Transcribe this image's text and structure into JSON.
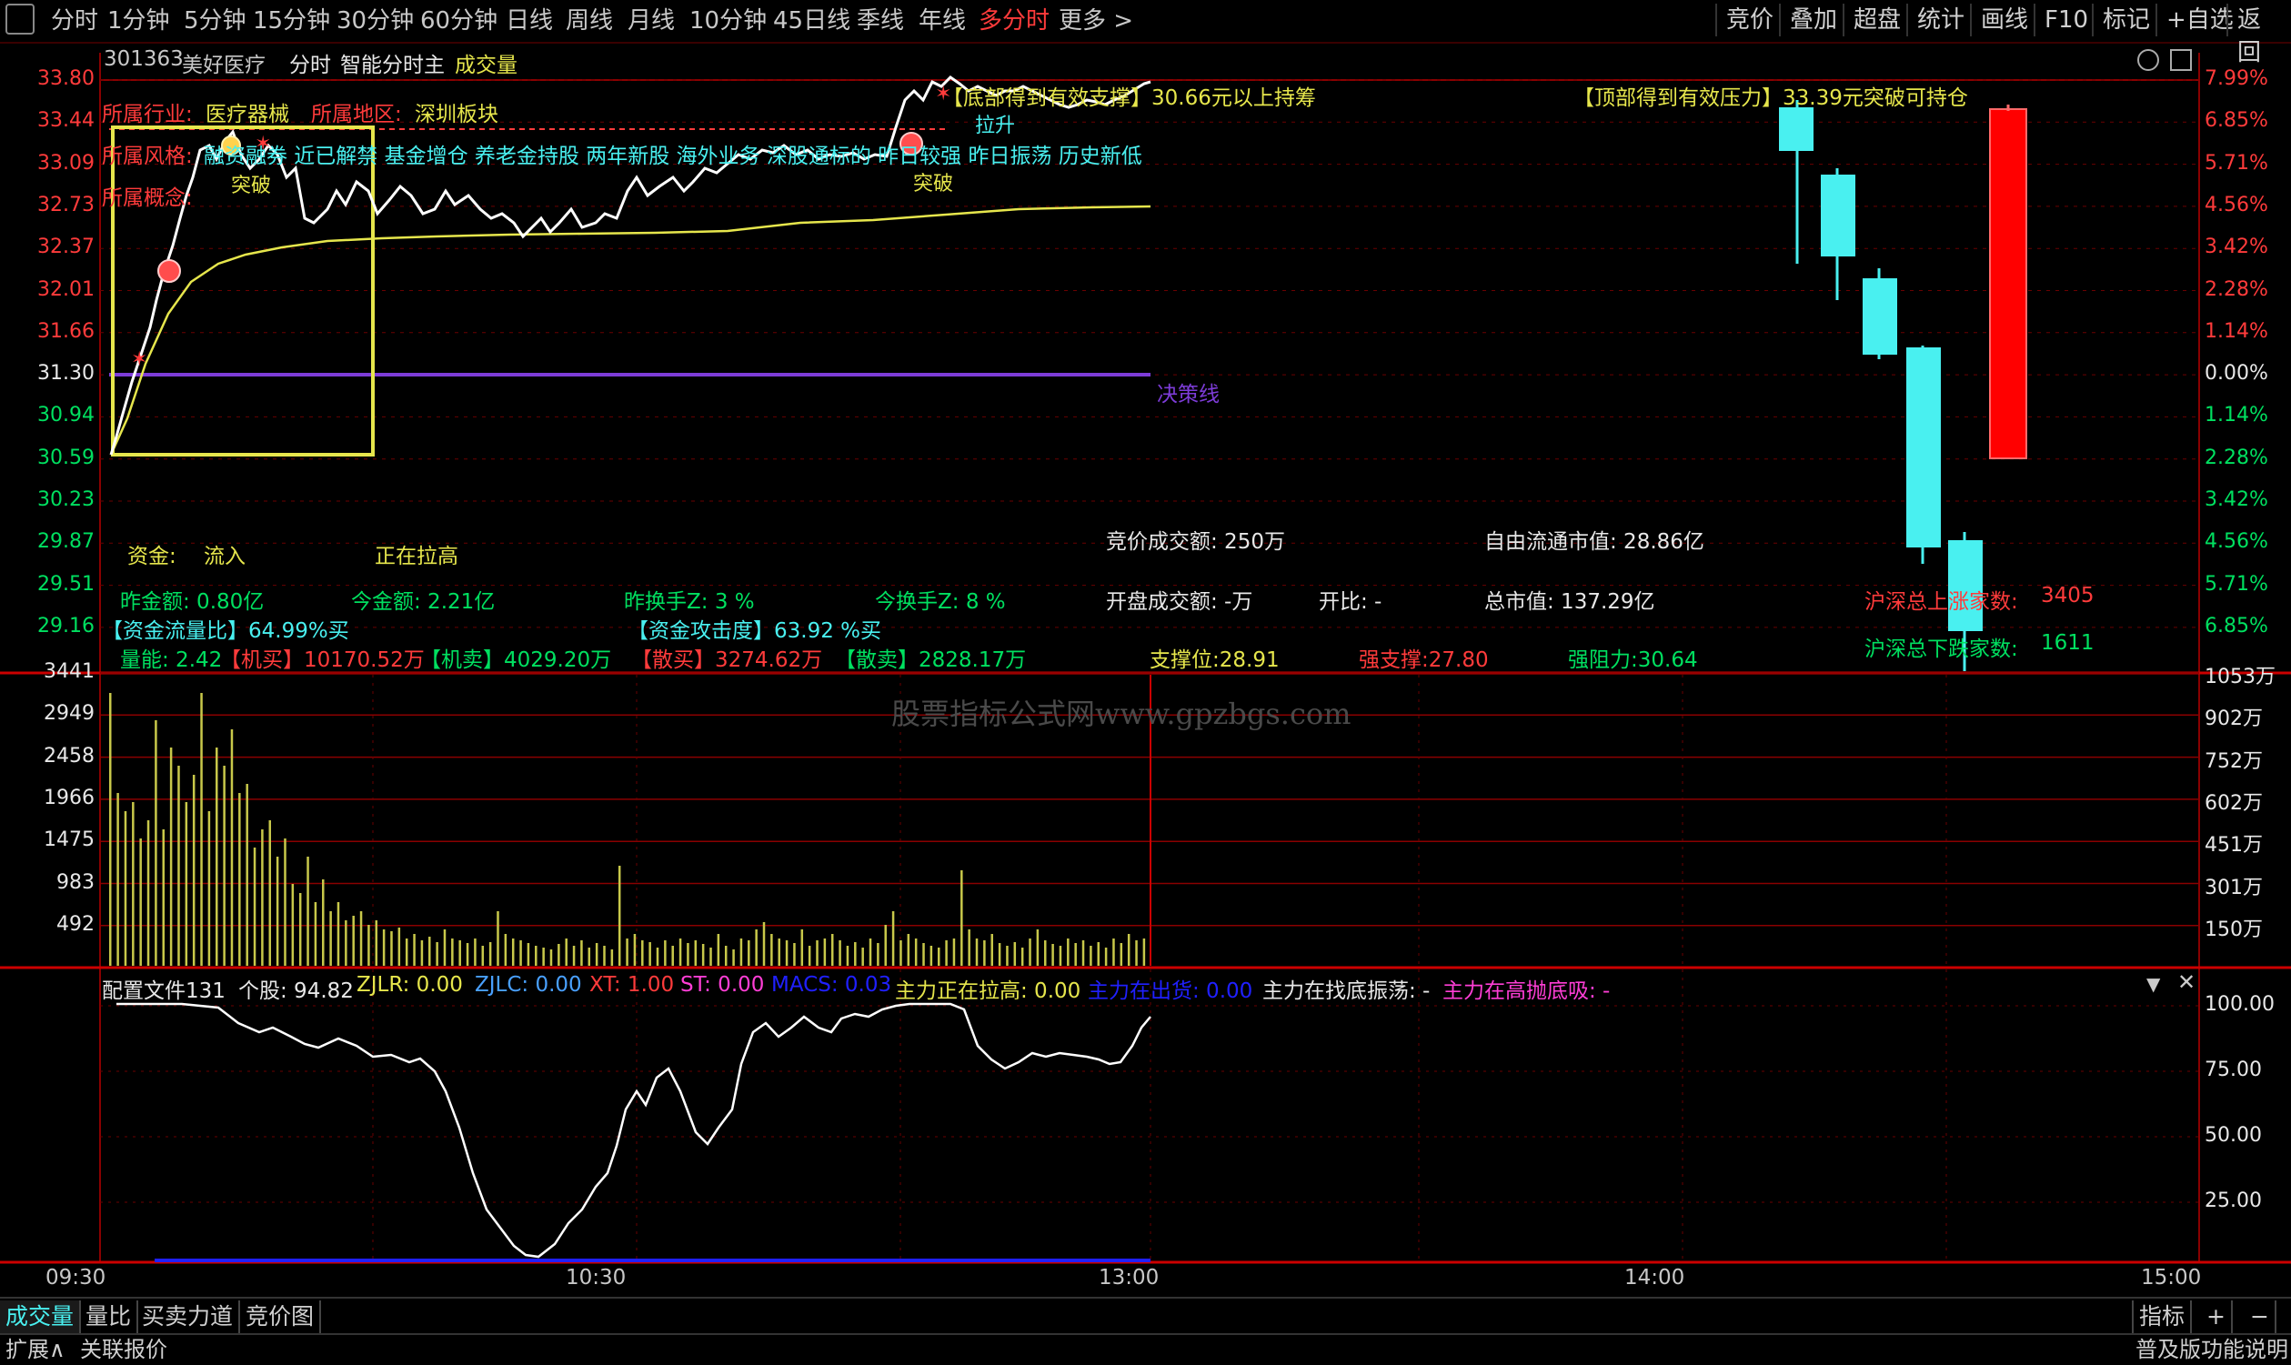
{
  "toolbar": {
    "periods": [
      "分时",
      "1分钟",
      "5分钟",
      "15分钟",
      "30分钟",
      "60分钟",
      "日线",
      "周线",
      "月线",
      "10分钟",
      "45日线",
      "季线",
      "年线",
      "多分时",
      "更多 >"
    ],
    "active_period": "多分时",
    "right_buttons": [
      "竞价",
      "叠加",
      "超盘",
      "统计",
      "画线",
      "F10",
      "标记",
      "+自选",
      "返回"
    ]
  },
  "header": {
    "code": "301363",
    "name": "美好医疗",
    "mode": "分时",
    "indicator_main": "智能分时主",
    "indicator_sub": "成交量"
  },
  "info": {
    "industry_label": "所属行业:",
    "industry_value": "医疗器械",
    "region_label": "所属地区:",
    "region_value": "深圳板块",
    "style_label": "所属风格:",
    "style_value": "融资融券 近已解禁 基金增仓 养老金持股 两年新股 海外业务 深股通标的 昨日较强 昨日振荡 历史新低",
    "concept_label": "所属概念:",
    "bottom_support": "【底部得到有效支撑】30.66元以上持筹",
    "top_pressure": "【顶部得到有效压力】33.39元突破可持仓",
    "decision_line": "决策线",
    "break_label_1": "突破",
    "break_label_2": "突破",
    "pull_label": "拉升"
  },
  "price_axis": {
    "left": [
      "33.80",
      "33.44",
      "33.09",
      "32.73",
      "32.37",
      "32.01",
      "31.66",
      "31.30",
      "30.94",
      "30.59",
      "30.23",
      "29.87",
      "29.51",
      "29.16"
    ],
    "right": [
      "7.99%",
      "6.85%",
      "5.71%",
      "4.56%",
      "3.42%",
      "2.28%",
      "1.14%",
      "0.00%",
      "1.14%",
      "2.28%",
      "3.42%",
      "4.56%",
      "5.71%",
      "6.85%"
    ]
  },
  "stats": {
    "fund_label": "资金:",
    "fund_flow": "流入",
    "fund_state": "正在拉高",
    "yesterday_amount": "昨金额: 0.80亿",
    "today_amount": "今金额: 2.21亿",
    "yesterday_turnover": "昨换手Z: 3 %",
    "today_turnover": "今换手Z: 8 %",
    "flow_ratio": "【资金流量比】64.99%买",
    "attack": "【资金攻击度】63.92 %买",
    "volume_ratio": "量能: 2.42",
    "inst_buy_label": "【机买】",
    "inst_buy": "10170.52万",
    "inst_sell_label": "【机卖】",
    "inst_sell": "4029.20万",
    "retail_buy_label": "【散买】",
    "retail_buy": "3274.62万",
    "retail_sell_label": "【散卖】",
    "retail_sell": "2828.17万",
    "auction_amount": "竞价成交额: 250万",
    "open_amount": "开盘成交额: -万",
    "open_ratio": "开比: -",
    "float_cap": "自由流通市值: 28.86亿",
    "total_cap": "总市值: 137.29亿",
    "support": "支撑位:28.91",
    "strong_support": "强支撑:27.80",
    "strong_resist": "强阻力:30.64",
    "up_count_label": "沪深总上涨家数:",
    "up_count": "3405",
    "down_count_label": "沪深总下跌家数:",
    "down_count": "1611"
  },
  "volume_axis": {
    "left": [
      "3441",
      "2949",
      "2458",
      "1966",
      "1475",
      "983",
      "492"
    ],
    "right": [
      "1053万",
      "902万",
      "752万",
      "602万",
      "451万",
      "301万",
      "150万"
    ]
  },
  "watermark": "股票指标公式网www.gpzbgs.com",
  "sub_indicator": {
    "name": "配置文件131",
    "stock": "个股: 94.82",
    "zjlr": "ZJLR: 0.00",
    "zjlc": "ZJLC: 0.00",
    "xt": "XT: 1.00",
    "st": "ST: 0.00",
    "macs": "MACS: 0.03",
    "pull": "主力正在拉高: 0.00",
    "out": "主力在出货: 0.00",
    "bottom": "主力在找底振荡: -",
    "high": "主力在高抛底吸: -",
    "axis": [
      "100.00",
      "75.00",
      "50.00",
      "25.00"
    ]
  },
  "time_axis": [
    "09:30",
    "10:30",
    "13:00",
    "14:00",
    "15:00"
  ],
  "bottom_tabs": [
    "成交量",
    "量比",
    "买卖力道",
    "竞价图"
  ],
  "bottom_right": [
    "指标",
    "+",
    "−"
  ],
  "bottom_bar": {
    "expand": "扩展∧",
    "linked": "关联报价",
    "help": "普及版功能说明"
  },
  "colors": {
    "up": "#ff3b3b",
    "down": "#00e060",
    "grid": "#8a0000",
    "price_line": "#ffffff",
    "avg_line": "#e6e64c",
    "decision": "#7d3cd8",
    "cyan": "#49f0f0"
  }
}
